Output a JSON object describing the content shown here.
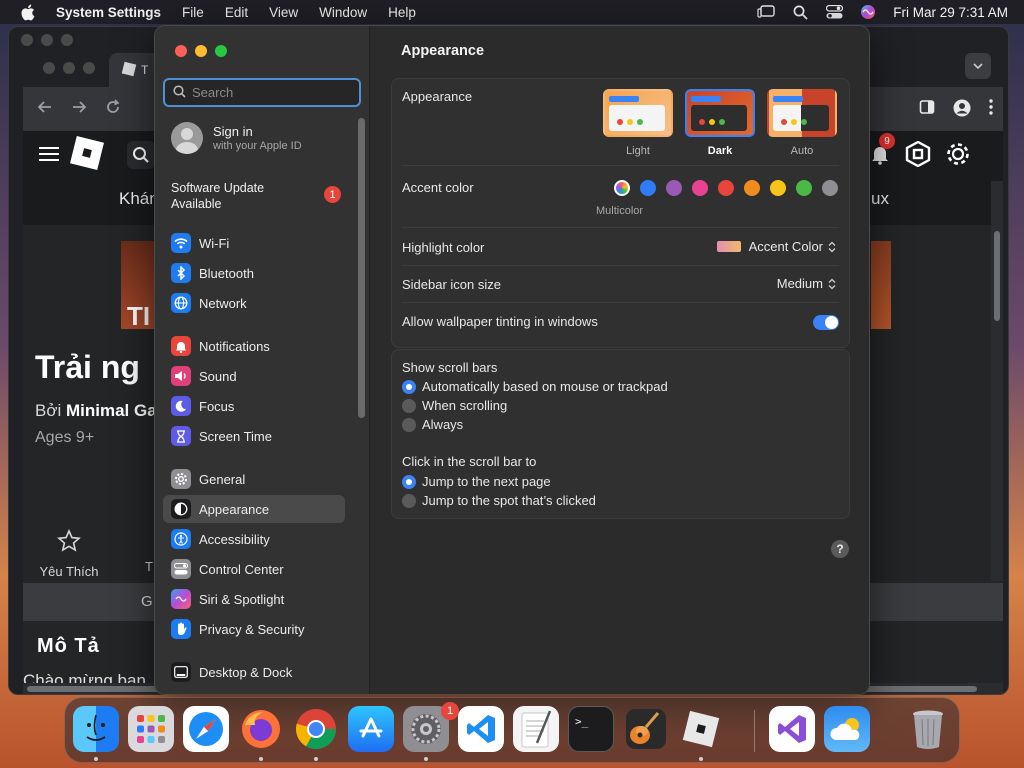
{
  "menubar": {
    "app_name": "System Settings",
    "menus": [
      "File",
      "Edit",
      "View",
      "Window",
      "Help"
    ],
    "clock": "Fri Mar 29  7:31 AM"
  },
  "browser": {
    "tab_title": "T",
    "site": {
      "nav_left": "Khán",
      "nav_right": "ux",
      "notification_count": "9",
      "hero_text": "TI",
      "game_title": "Trải ng",
      "by_prefix": "Bởi",
      "by_name": "Minimal Ga",
      "age": "Ages 9+",
      "favorite_label": "Yêu Thích",
      "second_action": "T",
      "bar_text": "G",
      "desc_title": "Mô Tả",
      "desc_text": "Chào mừng ban"
    }
  },
  "settings": {
    "search_placeholder": "Search",
    "signin_title": "Sign in",
    "signin_subtitle": "with your Apple ID",
    "software_update_line1": "Software Update",
    "software_update_line2": "Available",
    "software_update_badge": "1",
    "sidebar_items": [
      {
        "label": "Wi-Fi",
        "icon": "wifi-icon",
        "color": "#1e7cf2"
      },
      {
        "label": "Bluetooth",
        "icon": "bluetooth-icon",
        "color": "#1e7cf2"
      },
      {
        "label": "Network",
        "icon": "network-icon",
        "color": "#1e7cf2"
      },
      {
        "label": "Notifications",
        "icon": "notifications-icon",
        "color": "#e8453c"
      },
      {
        "label": "Sound",
        "icon": "sound-icon",
        "color": "#e0407a"
      },
      {
        "label": "Focus",
        "icon": "focus-icon",
        "color": "#5e5ce6"
      },
      {
        "label": "Screen Time",
        "icon": "screen-time-icon",
        "color": "#5e5ce6"
      },
      {
        "label": "General",
        "icon": "gear-icon",
        "color": "#8e8e93"
      },
      {
        "label": "Appearance",
        "icon": "appearance-icon",
        "color": "#1c1c1e"
      },
      {
        "label": "Accessibility",
        "icon": "accessibility-icon",
        "color": "#1e7cf2"
      },
      {
        "label": "Control Center",
        "icon": "control-center-icon",
        "color": "#8e8e93"
      },
      {
        "label": "Siri & Spotlight",
        "icon": "siri-icon",
        "color": "#b84cd6"
      },
      {
        "label": "Privacy & Security",
        "icon": "hand-icon",
        "color": "#1e7cf2"
      },
      {
        "label": "Desktop & Dock",
        "icon": "dock-icon",
        "color": "#1c1c1e"
      }
    ],
    "selected_item": "Appearance",
    "page_title": "Appearance",
    "appearance_label": "Appearance",
    "appearance_options": [
      "Light",
      "Dark",
      "Auto"
    ],
    "appearance_selected": "Dark",
    "accent_label": "Accent color",
    "accent_colors": [
      "multicolor",
      "#2f7cf6",
      "#9b59b6",
      "#e84393",
      "#e8453c",
      "#f08c1e",
      "#f5c518",
      "#4cb848",
      "#8e8e93"
    ],
    "accent_selected_label": "Multicolor",
    "highlight_label": "Highlight color",
    "highlight_value": "Accent Color",
    "sidebar_icon_size_label": "Sidebar icon size",
    "sidebar_icon_size_value": "Medium",
    "wallpaper_tinting_label": "Allow wallpaper tinting in windows",
    "wallpaper_tinting_on": true,
    "scroll_bars_label": "Show scroll bars",
    "scroll_bars_options": [
      "Automatically based on mouse or trackpad",
      "When scrolling",
      "Always"
    ],
    "scroll_bars_selected": 0,
    "click_scroll_label": "Click in the scroll bar to",
    "click_scroll_options": [
      "Jump to the next page",
      "Jump to the spot that’s clicked"
    ],
    "click_scroll_selected": 0,
    "help": "?"
  },
  "dock": {
    "apps": [
      "Finder",
      "Launchpad",
      "Safari",
      "Firefox",
      "Chrome",
      "App Store",
      "System Settings",
      "Visual Studio Code",
      "TextEdit",
      "Terminal",
      "GarageBand",
      "Roblox",
      "Visual Studio",
      "Weather",
      "Trash"
    ],
    "system_settings_badge": "1",
    "terminal_glyph": ">_"
  }
}
